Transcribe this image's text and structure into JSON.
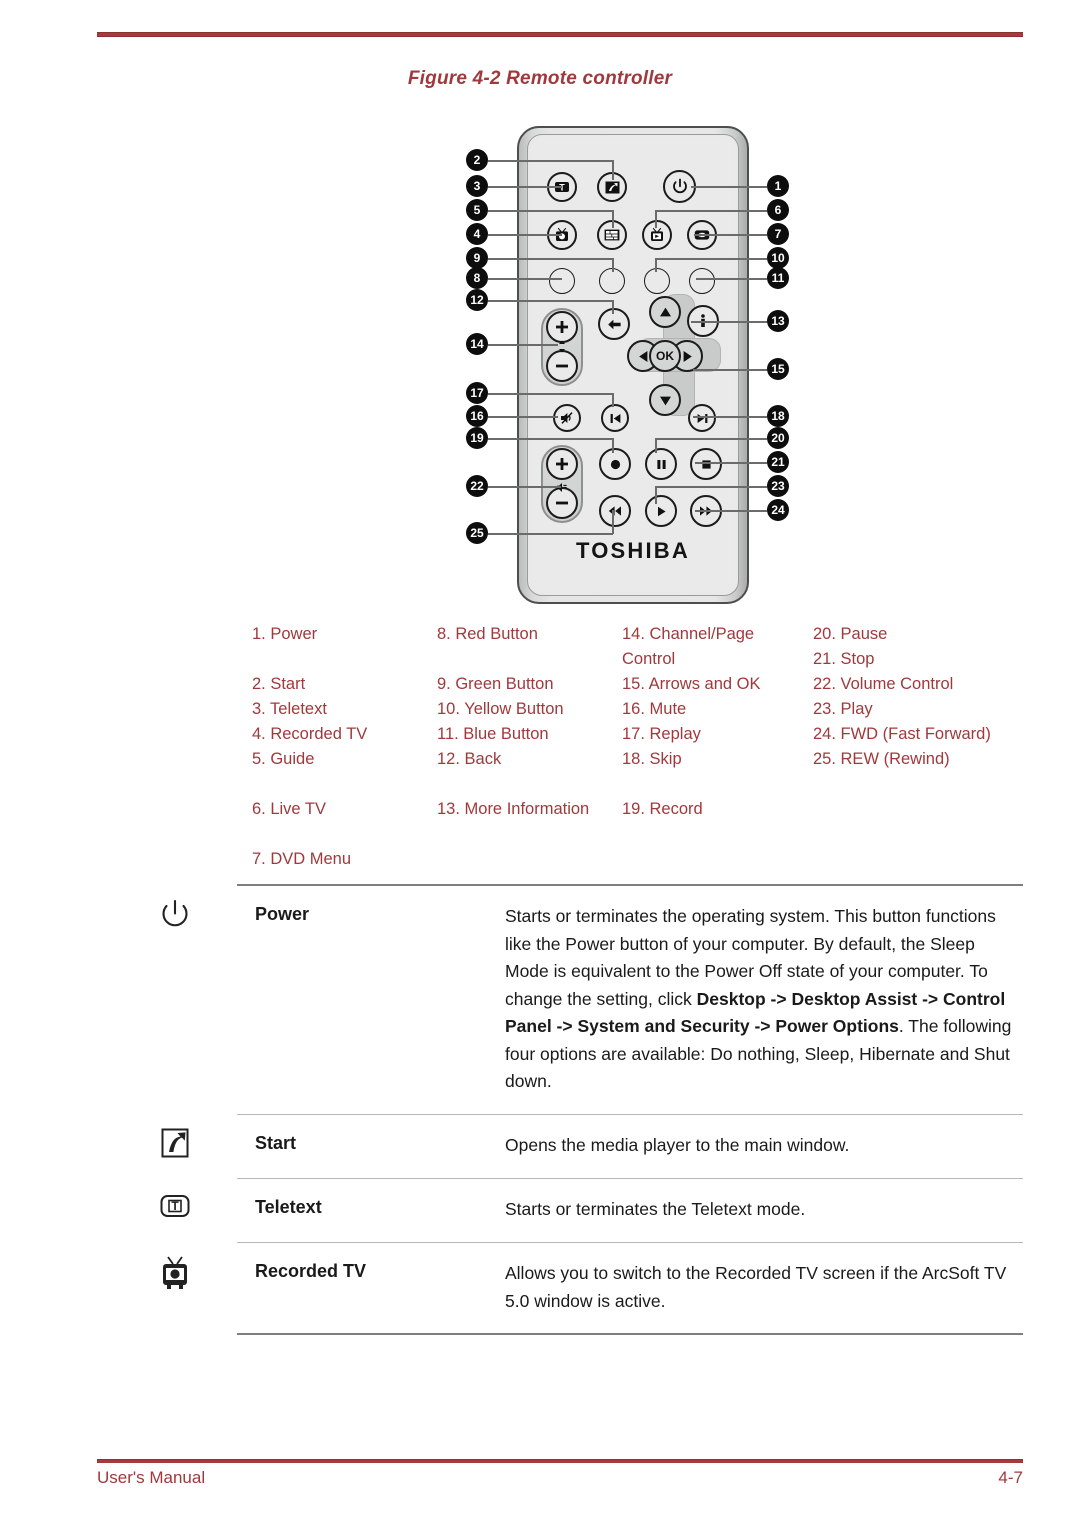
{
  "figure": {
    "caption": "Figure 4-2 Remote controller"
  },
  "remote": {
    "brand": "TOSHIBA",
    "callouts": [
      "1",
      "2",
      "3",
      "4",
      "5",
      "6",
      "7",
      "8",
      "9",
      "10",
      "11",
      "12",
      "13",
      "14",
      "15",
      "16",
      "17",
      "18",
      "19",
      "20",
      "21",
      "22",
      "23",
      "24",
      "25"
    ]
  },
  "legend": {
    "col1": [
      {
        "text": "1. Power"
      },
      {
        "text": "2. Start"
      },
      {
        "text": "3. Teletext"
      },
      {
        "text": "4. Recorded TV"
      },
      {
        "text": "5. Guide"
      },
      {
        "text": "6. Live TV"
      },
      {
        "text": "7. DVD Menu"
      }
    ],
    "col2": [
      {
        "text": "8. Red Button"
      },
      {
        "text": "9. Green Button"
      },
      {
        "text": "10. Yellow Button"
      },
      {
        "text": "11. Blue Button"
      },
      {
        "text": "12. Back"
      },
      {
        "text": "13. More Information"
      }
    ],
    "col3": [
      {
        "text": "14. Channel/Page Control"
      },
      {
        "text": "15. Arrows and OK"
      },
      {
        "text": "16. Mute"
      },
      {
        "text": "17. Replay"
      },
      {
        "text": "18. Skip"
      },
      {
        "text": "19. Record"
      }
    ],
    "col4": [
      {
        "text": "20. Pause"
      },
      {
        "text": "21. Stop"
      },
      {
        "text": "22. Volume Control"
      },
      {
        "text": "23. Play"
      },
      {
        "text": "24. FWD (Fast Forward)"
      },
      {
        "text": "25. REW (Rewind)"
      }
    ]
  },
  "descriptions": [
    {
      "icon": "power-icon",
      "name": "Power",
      "body_part1": "Starts or terminates the operating system. This button functions like the Power button of your computer. By default, the Sleep Mode is equivalent to the Power Off state of your computer. To change the setting, click ",
      "body_bold1": "Desktop -> Desktop Assist -> Control Panel -> System and Security -> Power Options",
      "body_part2": ". The following four options are available: Do nothing, Sleep, Hibernate and Shut down."
    },
    {
      "icon": "start-arrow-icon",
      "name": "Start",
      "body_part1": "Opens the media player to the main window.",
      "body_bold1": "",
      "body_part2": ""
    },
    {
      "icon": "teletext-icon",
      "name": "Teletext",
      "body_part1": "Starts or terminates the Teletext mode.",
      "body_bold1": "",
      "body_part2": ""
    },
    {
      "icon": "recorded-tv-icon",
      "name": "Recorded TV",
      "body_part1": "Allows you to switch to the Recorded TV screen if the ArcSoft TV 5.0 window is active.",
      "body_bold1": "",
      "body_part2": ""
    }
  ],
  "footer": {
    "left": "User's Manual",
    "right": "4-7"
  },
  "colors": {
    "accent": "#a0393c",
    "rule": "#a43a3d",
    "text": "#1a1a1a"
  }
}
